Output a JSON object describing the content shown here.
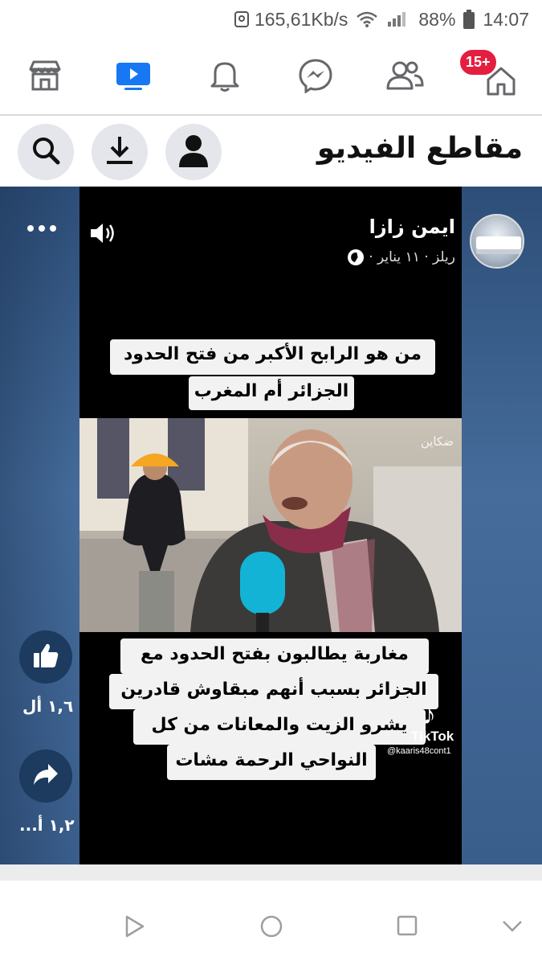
{
  "status_bar": {
    "speed": "165,61Kb/s",
    "battery": "88%",
    "time": "14:07",
    "icons": [
      "sim-icon",
      "wifi-icon",
      "signal-icon",
      "battery-icon"
    ]
  },
  "nav": {
    "items": [
      "marketplace-icon",
      "video-icon",
      "notifications-icon",
      "messenger-icon",
      "friends-icon",
      "home-icon"
    ],
    "home_badge": "15+",
    "accent_color": "#1877f2",
    "badge_color": "#e41e3f"
  },
  "header": {
    "title": "مقاطع الفيديو",
    "buttons": [
      "search-icon",
      "download-icon",
      "profile-icon"
    ]
  },
  "post": {
    "author": "ايمن زازا",
    "meta": "ريلز · ١١ يناير ·",
    "caption_top": [
      "من هو الرابح الأكبر من فتح الحدود",
      "الجزائر أم المغرب"
    ],
    "caption_bottom": [
      "مغاربة يطالبون بفتح الحدود مع",
      "الجزائر بسبب أنهم مبقاوش قادرين",
      "يشرو الزيت والمعانات من كل",
      "النواحي الرحمة مشات"
    ],
    "microphone_brand": "achkayen",
    "tiktok": {
      "name": "TikTok",
      "handle": "@kaaris48cont1"
    },
    "likes": "١,٦ أل",
    "shares": "١,٢ أ..."
  }
}
